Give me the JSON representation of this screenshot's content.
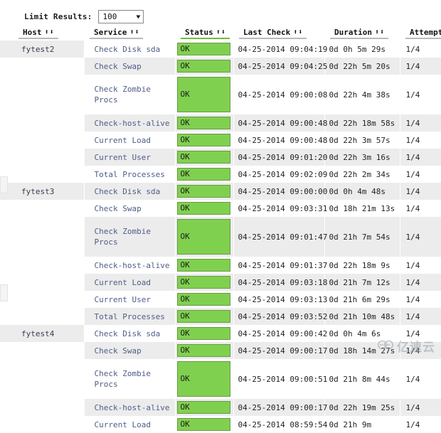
{
  "controls": {
    "limit_label": "Limit Results:",
    "limit_value": "100",
    "limit_caret": "▼"
  },
  "table": {
    "columns": [
      {
        "key": "host",
        "label": "Host"
      },
      {
        "key": "service",
        "label": "Service"
      },
      {
        "key": "status",
        "label": "Status"
      },
      {
        "key": "last",
        "label": "Last Check"
      },
      {
        "key": "duration",
        "label": "Duration"
      },
      {
        "key": "attempt",
        "label": "Attempt"
      }
    ],
    "sort_up": "⬆",
    "sort_down": "⬇",
    "rows": [
      {
        "host": "fytest2",
        "service": [
          "Check Disk sda"
        ],
        "status": "OK",
        "last": "04-25-2014 09:04:19",
        "duration": "0d 0h 5m 29s",
        "attempt": "1/4"
      },
      {
        "host": "",
        "service": [
          "Check Swap"
        ],
        "status": "OK",
        "last": "04-25-2014 09:04:25",
        "duration": "0d 22h 5m 20s",
        "attempt": "1/4"
      },
      {
        "host": "",
        "service": [
          "Check Zombie",
          "Procs"
        ],
        "status": "OK",
        "last": "04-25-2014 09:00:08",
        "duration": "0d 22h 4m 38s",
        "attempt": "1/4"
      },
      {
        "host": "",
        "service": [
          "Check-host-alive"
        ],
        "status": "OK",
        "last": "04-25-2014 09:00:48",
        "duration": "0d 22h 18m 58s",
        "attempt": "1/4"
      },
      {
        "host": "",
        "service": [
          "Current Load"
        ],
        "status": "OK",
        "last": "04-25-2014 09:00:48",
        "duration": "0d 22h 3m 57s",
        "attempt": "1/4"
      },
      {
        "host": "",
        "service": [
          "Current User"
        ],
        "status": "OK",
        "last": "04-25-2014 09:01:20",
        "duration": "0d 22h 3m 16s",
        "attempt": "1/4"
      },
      {
        "host": "",
        "service": [
          "Total Processes"
        ],
        "status": "OK",
        "last": "04-25-2014 09:02:09",
        "duration": "0d 22h 2m 34s",
        "attempt": "1/4"
      },
      {
        "host": "fytest3",
        "service": [
          "Check Disk sda"
        ],
        "status": "OK",
        "last": "04-25-2014 09:00:00",
        "duration": "0d 0h 4m 48s",
        "attempt": "1/4"
      },
      {
        "host": "",
        "service": [
          "Check Swap"
        ],
        "status": "OK",
        "last": "04-25-2014 09:03:31",
        "duration": "0d 18h 21m 13s",
        "attempt": "1/4"
      },
      {
        "host": "",
        "service": [
          "Check Zombie",
          "Procs"
        ],
        "status": "OK",
        "last": "04-25-2014 09:01:47",
        "duration": "0d 21h 7m 54s",
        "attempt": "1/4"
      },
      {
        "host": "",
        "service": [
          "Check-host-alive"
        ],
        "status": "OK",
        "last": "04-25-2014 09:01:37",
        "duration": "0d 22h 18m 9s",
        "attempt": "1/4"
      },
      {
        "host": "",
        "service": [
          "Current Load"
        ],
        "status": "OK",
        "last": "04-25-2014 09:03:18",
        "duration": "0d 21h 7m 12s",
        "attempt": "1/4"
      },
      {
        "host": "",
        "service": [
          "Current User"
        ],
        "status": "OK",
        "last": "04-25-2014 09:03:13",
        "duration": "0d 21h 6m 29s",
        "attempt": "1/4"
      },
      {
        "host": "",
        "service": [
          "Total Processes"
        ],
        "status": "OK",
        "last": "04-25-2014 09:03:52",
        "duration": "0d 21h 10m 48s",
        "attempt": "1/4"
      },
      {
        "host": "fytest4",
        "service": [
          "Check Disk sda"
        ],
        "status": "OK",
        "last": "04-25-2014 09:00:42",
        "duration": "0d 0h 4m 6s",
        "attempt": "1/4"
      },
      {
        "host": "",
        "service": [
          "Check Swap"
        ],
        "status": "OK",
        "last": "04-25-2014 09:00:17",
        "duration": "0d 18h 14m 27s",
        "attempt": "1/4"
      },
      {
        "host": "",
        "service": [
          "Check Zombie",
          "Procs"
        ],
        "status": "OK",
        "last": "04-25-2014 09:00:51",
        "duration": "0d 21h 8m 44s",
        "attempt": "1/4"
      },
      {
        "host": "",
        "service": [
          "Check-host-alive"
        ],
        "status": "OK",
        "last": "04-25-2014 09:00:17",
        "duration": "0d 22h 19m 25s",
        "attempt": "1/4"
      },
      {
        "host": "",
        "service": [
          "Current Load"
        ],
        "status": "OK",
        "last": "04-25-2014 08:59:54",
        "duration": "0d 21h 9m",
        "attempt": "1/4"
      }
    ]
  },
  "watermark": {
    "text": "亿速云"
  },
  "colors": {
    "status_ok_bg": "#80d050",
    "status_ok_border": "#6a9a45",
    "row_alt_bg": "#ececec",
    "service_link": "#4f5c87",
    "status_header_underline": "#6fbf3f"
  }
}
